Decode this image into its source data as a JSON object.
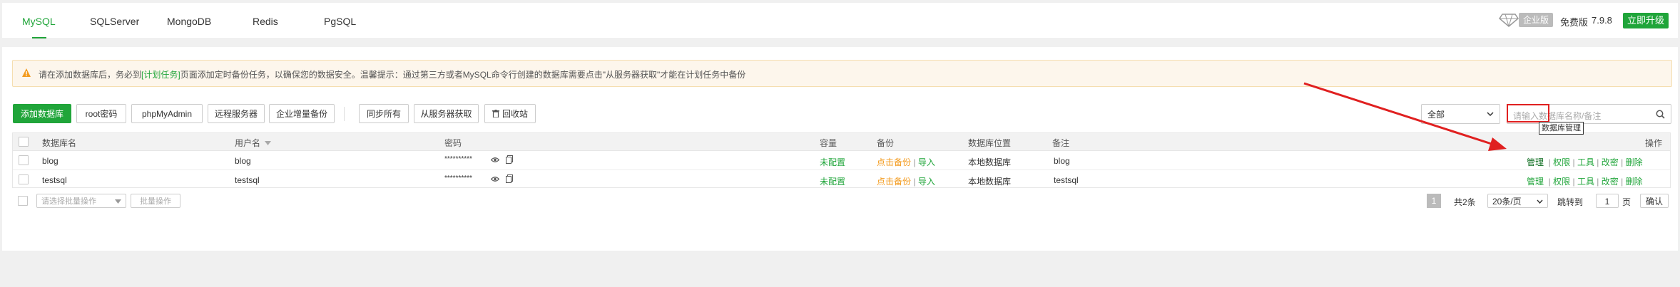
{
  "tabs": [
    {
      "label": "MySQL",
      "active": true
    },
    {
      "label": "SQLServer"
    },
    {
      "label": "MongoDB"
    },
    {
      "label": "Redis"
    },
    {
      "label": "PgSQL"
    }
  ],
  "header_right": {
    "edition_badge": "企业版",
    "free_label": "免费版",
    "version": "7.9.8",
    "upgrade_label": "立即升级"
  },
  "alert": {
    "part1": "请在添加数据库后，务必到",
    "link": "[计划任务]",
    "part2": "页面添加定时备份任务，以确保您的数据安全。温馨提示：通过第三方或者MySQL命令行创建的数据库需要点击\"从服务器获取\"才能在计划任务中备份"
  },
  "toolbar": {
    "add_db": "添加数据库",
    "root_pwd": "root密码",
    "phpmyadmin": "phpMyAdmin",
    "remote_server": "远程服务器",
    "enterprise_backup": "企业增量备份",
    "sync_all": "同步所有",
    "get_from_server": "从服务器获取",
    "recycle_bin": "回收站",
    "filter_selected": "全部",
    "search_placeholder": "请输入数据库名称/备注"
  },
  "table": {
    "headers": {
      "db_name": "数据库名",
      "user_name": "用户名",
      "password": "密码",
      "capacity": "容量",
      "backup": "备份",
      "location": "数据库位置",
      "remark": "备注",
      "ops": "操作"
    },
    "rows": [
      {
        "db": "blog",
        "user": "blog",
        "password": "**********",
        "capacity": "未配置",
        "backup": "点击备份",
        "import": "导入",
        "location": "本地数据库",
        "remark": "blog",
        "ops": [
          "管理",
          "权限",
          "工具",
          "改密",
          "删除"
        ]
      },
      {
        "db": "testsql",
        "user": "testsql",
        "password": "**********",
        "capacity": "未配置",
        "backup": "点击备份",
        "import": "导入",
        "location": "本地数据库",
        "remark": "testsql",
        "ops": [
          "管理",
          "权限",
          "工具",
          "改密",
          "删除"
        ]
      }
    ]
  },
  "footer": {
    "batch_select_placeholder": "请选择批量操作",
    "batch_button": "批量操作",
    "current_page": "1",
    "total": "共2条",
    "per_page": "20条/页",
    "jump_to": "跳转到",
    "page_input": "1",
    "page_unit": "页",
    "confirm": "确认"
  },
  "tooltip": "数据库管理",
  "colors": {
    "accent": "#20a53a",
    "warning": "#f39b1e",
    "highlight": "#e02020"
  }
}
